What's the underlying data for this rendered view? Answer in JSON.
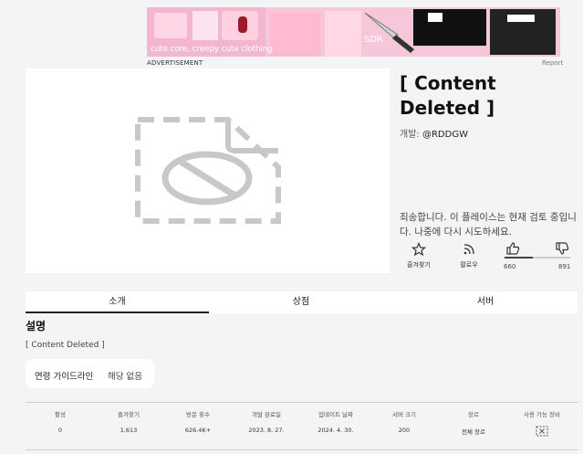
{
  "ad": {
    "banner_text": "cute core, creepy cute clothing",
    "corner_text": "SDR",
    "label": "ADVERTISEMENT",
    "report": "Report"
  },
  "game": {
    "title": "[ Content Deleted ]",
    "developer_prefix": "개발:",
    "developer": "@RDDGW",
    "notice": "죄송합니다. 이 플레이스는 현재 검토 중입니다. 나중에 다시 시도하세요."
  },
  "actions": {
    "favorite_label": "즐겨찾기",
    "follow_label": "팔로우",
    "upvotes": "660",
    "downvotes": "891",
    "upvote_fraction": 0.43
  },
  "tabs": [
    "소개",
    "상점",
    "서버"
  ],
  "about": {
    "heading": "설명",
    "description": "[ Content Deleted ]",
    "age_label": "연령 가이드라인",
    "age_value": "해당 없음"
  },
  "stats": [
    {
      "label": "활성",
      "value": "0"
    },
    {
      "label": "즐겨찾기",
      "value": "1,613"
    },
    {
      "label": "방문 횟수",
      "value": "626.4K+"
    },
    {
      "label": "개발 완료일",
      "value": "2023. 8. 27."
    },
    {
      "label": "업데이트 날짜",
      "value": "2024. 4. 30."
    },
    {
      "label": "서버 크기",
      "value": "200"
    },
    {
      "label": "장르",
      "value": "전체 장르"
    },
    {
      "label": "사용 가능 장비",
      "value": ""
    }
  ],
  "colors": {
    "background": "#f2f4f5",
    "card": "#ffffff",
    "ad_pink": "#f6c7d9",
    "placeholder_gray": "#c8c8c8"
  }
}
